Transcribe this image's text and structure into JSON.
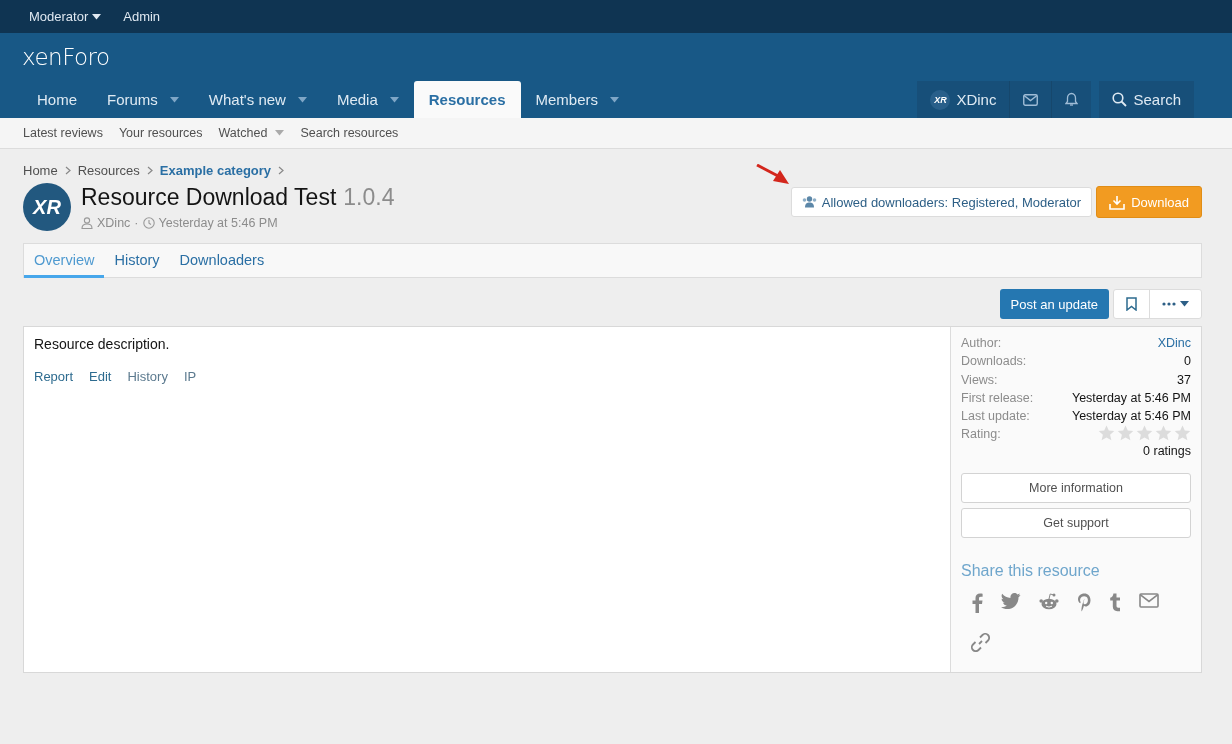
{
  "staff_bar": {
    "items": [
      {
        "label": "Moderator",
        "dropdown": true
      },
      {
        "label": "Admin",
        "dropdown": false
      }
    ]
  },
  "header": {
    "logo": "xenForo"
  },
  "nav": {
    "tabs": [
      {
        "label": "Home",
        "dropdown": false,
        "selected": false
      },
      {
        "label": "Forums",
        "dropdown": true,
        "selected": false
      },
      {
        "label": "What's new",
        "dropdown": true,
        "selected": false
      },
      {
        "label": "Media",
        "dropdown": true,
        "selected": false
      },
      {
        "label": "Resources",
        "dropdown": false,
        "selected": true
      },
      {
        "label": "Members",
        "dropdown": true,
        "selected": false
      }
    ],
    "account": {
      "username": "XDinc",
      "avatar_text": "XR"
    },
    "search": "Search"
  },
  "sub_nav": {
    "items": [
      {
        "label": "Latest reviews",
        "dropdown": false
      },
      {
        "label": "Your resources",
        "dropdown": false
      },
      {
        "label": "Watched",
        "dropdown": true
      },
      {
        "label": "Search resources",
        "dropdown": false
      }
    ]
  },
  "breadcrumbs": [
    {
      "label": "Home",
      "current": false
    },
    {
      "label": "Resources",
      "current": false
    },
    {
      "label": "Example category",
      "current": true
    }
  ],
  "resource": {
    "avatar_text": "XR",
    "title": "Resource Download Test",
    "version": "1.0.4",
    "author": "XDinc",
    "meta_separator": "·",
    "date": "Yesterday at 5:46 PM",
    "allowed_downloaders": "Allowed downloaders: Registered, Moderator",
    "download_button": "Download"
  },
  "tabs": [
    {
      "label": "Overview",
      "selected": true
    },
    {
      "label": "History",
      "selected": false
    },
    {
      "label": "Downloaders",
      "selected": false
    }
  ],
  "actions": {
    "post_update": "Post an update"
  },
  "description": {
    "text": "Resource description.",
    "links": [
      "Report",
      "Edit",
      "History",
      "IP"
    ]
  },
  "info": {
    "rows": [
      {
        "label": "Author:",
        "value": "XDinc",
        "kind": "link"
      },
      {
        "label": "Downloads:",
        "value": "0",
        "kind": "text"
      },
      {
        "label": "Views:",
        "value": "37",
        "kind": "text"
      },
      {
        "label": "First release:",
        "value": "Yesterday at 5:46 PM",
        "kind": "text"
      },
      {
        "label": "Last update:",
        "value": "Yesterday at 5:46 PM",
        "kind": "text"
      },
      {
        "label": "Rating:",
        "stars": 0,
        "kind": "rating"
      }
    ],
    "ratings_count": "0 ratings",
    "buttons": [
      "More information",
      "Get support"
    ],
    "share_title": "Share this resource"
  }
}
